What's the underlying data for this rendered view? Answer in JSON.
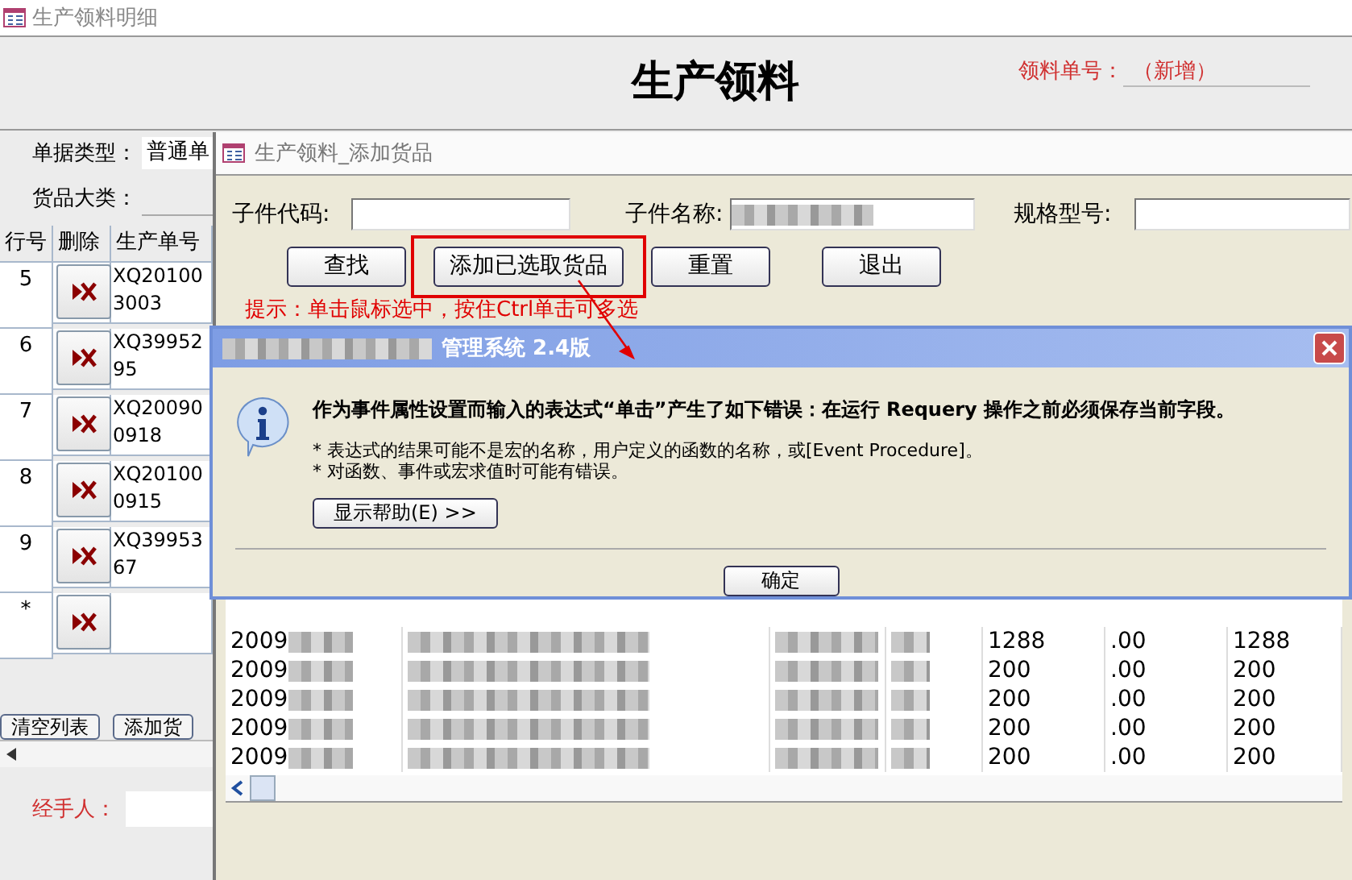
{
  "window": {
    "title": "生产领料明细"
  },
  "header": {
    "title": "生产领料",
    "order_no_label": "领料单号：",
    "order_no_value": "（新增）"
  },
  "form": {
    "fields": [
      {
        "label": "单据类型：",
        "value": "普通单"
      },
      {
        "label": "货品大类："
      }
    ]
  },
  "lines": {
    "columns": [
      "行号",
      "删除",
      "生产单号"
    ],
    "rows": [
      {
        "line": "5",
        "order_no": "XQ20100\n3003"
      },
      {
        "line": "6",
        "order_no": "XQ39952\n95"
      },
      {
        "line": "7",
        "order_no": "XQ20090\n0918"
      },
      {
        "line": "8",
        "order_no": "XQ20100\n0915"
      },
      {
        "line": "9",
        "order_no": "XQ39953\n67"
      },
      {
        "line": "*"
      }
    ]
  },
  "list_buttons": [
    "清空列表",
    "添加货"
  ],
  "handler_label": "经手人：",
  "dialog": {
    "title": "生产领料_添加货品",
    "filters": [
      {
        "label": "子件代码:",
        "blurred": false
      },
      {
        "label": "子件名称:",
        "blurred": true
      },
      {
        "label": "规格型号:",
        "blurred": false
      }
    ],
    "buttons": [
      {
        "label": "查找",
        "highlighted": false
      },
      {
        "label": "添加已选取货品",
        "highlighted": true
      },
      {
        "label": "重置",
        "highlighted": false
      },
      {
        "label": "退出",
        "highlighted": false
      }
    ],
    "hint": "提示：单击鼠标选中，按住Ctrl单击可多选",
    "rows": [
      {
        "code": "2009",
        "qty": "1288",
        "price": ".00",
        "total": "1288"
      },
      {
        "code": "2009",
        "qty": "200",
        "price": ".00",
        "total": "200"
      },
      {
        "code": "2009",
        "qty": "200",
        "price": ".00",
        "total": "200"
      },
      {
        "code": "2009",
        "qty": "200",
        "price": ".00",
        "total": "200"
      },
      {
        "code": "2009",
        "qty": "200",
        "price": ".00",
        "total": "200"
      }
    ]
  },
  "message_box": {
    "title": "管理系统 2.4版",
    "message": "作为事件属性设置而输入的表达式“单击”产生了如下错误：在运行 Requery 操作之前必须保存当前字段。",
    "details": [
      "* 表达式的结果可能不是宏的名称，用户定义的函数的名称，或[Event Procedure]。",
      "* 对函数、事件或宏求值时可能有错误。"
    ],
    "help_button": "显示帮助(E) >>",
    "ok_button": "确定"
  }
}
